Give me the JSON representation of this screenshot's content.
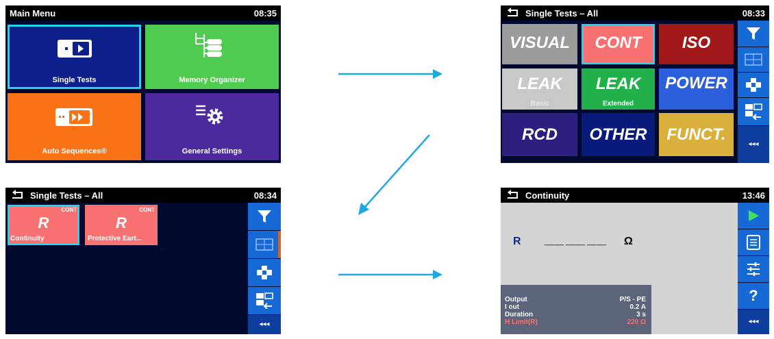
{
  "main_menu": {
    "title": "Main Menu",
    "time": "08:35",
    "tiles": [
      {
        "label": "Single Tests"
      },
      {
        "label": "Memory Organizer"
      },
      {
        "label": "Auto Sequences®"
      },
      {
        "label": "General Settings"
      }
    ]
  },
  "single_tests": {
    "title": "Single Tests – All",
    "time": "08:33",
    "tiles": [
      {
        "label": "VISUAL",
        "sub": ""
      },
      {
        "label": "CONT",
        "sub": ""
      },
      {
        "label": "ISO",
        "sub": ""
      },
      {
        "label": "LEAK",
        "sub": "Basic"
      },
      {
        "label": "LEAK",
        "sub": "Extended"
      },
      {
        "label": "POWER",
        "sub": ""
      },
      {
        "label": "RCD",
        "sub": ""
      },
      {
        "label": "OTHER",
        "sub": ""
      },
      {
        "label": "FUNCT.",
        "sub": ""
      }
    ],
    "more": "◂◂◂"
  },
  "cont_list": {
    "title": "Single Tests – All",
    "time": "08:34",
    "items": [
      {
        "symbol": "R",
        "tag": "CONT",
        "name": "Continuity"
      },
      {
        "symbol": "R",
        "tag": "CONT",
        "name": "Protective Eart..."
      }
    ],
    "more": "◂◂◂"
  },
  "continuity": {
    "title": "Continuity",
    "time": "13:46",
    "result_label": "R",
    "result_value": "___ ___ ___",
    "result_unit": "Ω",
    "params": [
      {
        "key": "Output",
        "value": "P/S - PE"
      },
      {
        "key": "I out",
        "value": "0.2 A"
      },
      {
        "key": "Duration",
        "value": "3 s"
      },
      {
        "key": "H Limit(R)",
        "value": "220 Ω"
      }
    ],
    "more": "◂◂◂",
    "help": "?"
  },
  "colors": {
    "accent_cyan": "#22d3ee",
    "sidebar_blue": "#1769d6",
    "limit_red": "#f87171"
  }
}
